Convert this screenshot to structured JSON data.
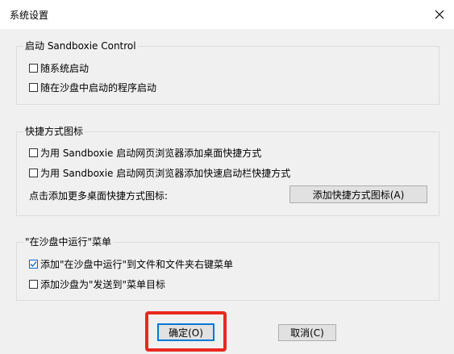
{
  "window": {
    "title": "系统设置"
  },
  "groups": {
    "startup": {
      "legend": "启动 Sandboxie Control",
      "options": [
        {
          "label": "随系统启动",
          "checked": false
        },
        {
          "label": "随在沙盘中启动的程序启动",
          "checked": false
        }
      ]
    },
    "shortcuts": {
      "legend": "快捷方式图标",
      "options": [
        {
          "label": "为用 Sandboxie 启动网页浏览器添加桌面快捷方式",
          "checked": false
        },
        {
          "label": "为用 Sandboxie 启动网页浏览器添加快速启动栏快捷方式",
          "checked": false
        }
      ],
      "more_text": "点击添加更多桌面快捷方式图标:",
      "add_button": "添加快捷方式图标(A)"
    },
    "run_menu": {
      "legend": "\"在沙盘中运行\"菜单",
      "options": [
        {
          "label": "添加\"在沙盘中运行\"到文件和文件夹右键菜单",
          "checked": true
        },
        {
          "label": "添加沙盘为\"发送到\"菜单目标",
          "checked": false
        }
      ]
    }
  },
  "footer": {
    "ok_label": "确定(O)",
    "cancel_label": "取消(C)"
  },
  "icons": {
    "close": "close-icon",
    "check": "checkmark-icon"
  },
  "colors": {
    "highlight": "#e8281f",
    "accent": "#0078d7"
  }
}
